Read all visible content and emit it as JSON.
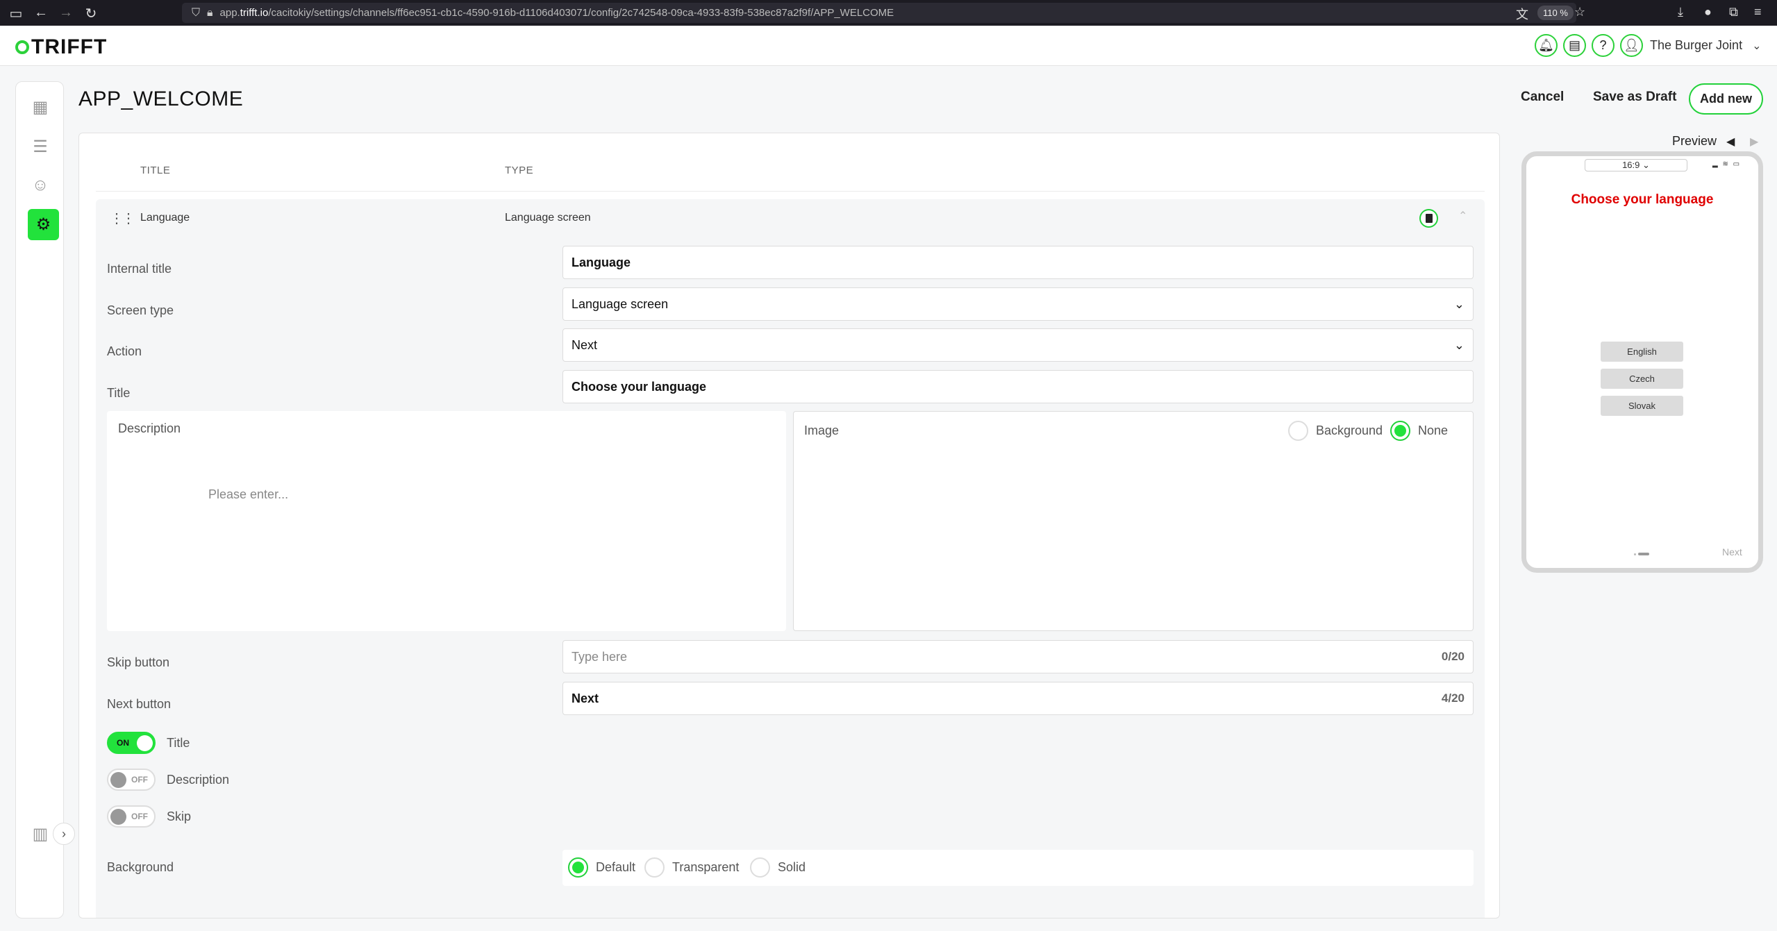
{
  "browser": {
    "url_prefix": "app.",
    "url_host": "trifft.io",
    "url_path": "/cacitokiy/settings/channels/ff6ec951-cb1c-4590-916b-d1106d403071/config/2c742548-09ca-4933-83f9-538ec87a2f9f/APP_WELCOME",
    "zoom": "110 %"
  },
  "header": {
    "logo": "TRIFFT",
    "account_name": "The Burger Joint"
  },
  "page": {
    "title": "APP_WELCOME",
    "cancel": "Cancel",
    "save_draft": "Save as Draft",
    "add_new": "Add new"
  },
  "table": {
    "col_title": "TITLE",
    "col_type": "TYPE",
    "row": {
      "title": "Language",
      "type": "Language screen"
    }
  },
  "form": {
    "internal_title_label": "Internal title",
    "internal_title_value": "Language",
    "screen_type_label": "Screen type",
    "screen_type_value": "Language screen",
    "action_label": "Action",
    "action_value": "Next",
    "title_label": "Title",
    "title_value": "Choose your language",
    "description_label": "Description",
    "description_placeholder": "Please enter...",
    "image_label": "Image",
    "image_opt_background": "Background",
    "image_opt_none": "None",
    "skip_label": "Skip button",
    "skip_placeholder": "Type here",
    "skip_counter": "0/20",
    "next_label": "Next button",
    "next_value": "Next",
    "next_counter": "4/20",
    "toggle_on_text": "ON",
    "toggle_off_text": "OFF",
    "toggle_title": "Title",
    "toggle_description": "Description",
    "toggle_skip": "Skip",
    "background_label": "Background",
    "bg_default": "Default",
    "bg_transparent": "Transparent",
    "bg_solid": "Solid"
  },
  "preview": {
    "label": "Preview",
    "ratio": "16:9",
    "title": "Choose your language",
    "languages": [
      "English",
      "Czech",
      "Slovak"
    ],
    "next": "Next"
  },
  "colors": {
    "accent": "#22e23c",
    "preview_title": "#e00000"
  }
}
